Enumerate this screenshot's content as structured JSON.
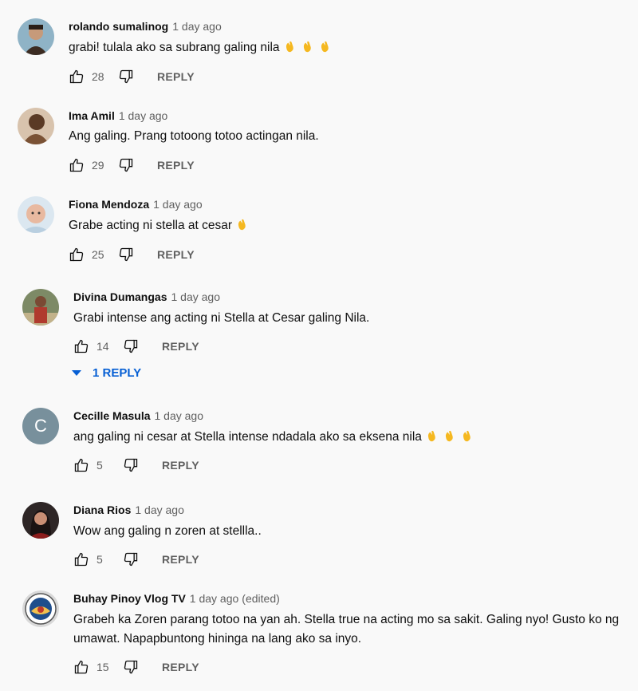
{
  "comments": [
    {
      "author": "rolando sumalinog",
      "time": "1 day ago",
      "text": "grabi! tulala ako sa subrang galing nila",
      "claps": 3,
      "likes": "28",
      "reply_label": "REPLY",
      "avatar_colors": [
        "#7fa3b8",
        "#3c2c22"
      ]
    },
    {
      "author": "Ima Amil",
      "time": "1 day ago",
      "text": "Ang galing. Prang totoong totoo actingan nila.",
      "claps": 0,
      "likes": "29",
      "reply_label": "REPLY",
      "avatar_colors": [
        "#c9ab8f",
        "#5a3a25"
      ]
    },
    {
      "author": "Fiona Mendoza",
      "time": "1 day ago",
      "text": "Grabe acting ni stella at cesar",
      "claps": 1,
      "likes": "25",
      "reply_label": "REPLY",
      "avatar_colors": [
        "#dbe7f0",
        "#e8b9a0"
      ]
    },
    {
      "author": "Divina Dumangas",
      "time": "1 day ago",
      "text": "Grabi intense ang acting ni Stella at Cesar galing Nila.",
      "claps": 0,
      "likes": "14",
      "reply_label": "REPLY",
      "avatar_colors": [
        "#6c7f54",
        "#b03a2e"
      ],
      "replies_toggle": "1 REPLY"
    },
    {
      "author": "Cecille Masula",
      "time": "1 day ago",
      "text": "ang galing ni cesar at Stella intense ndadala ako sa eksena nila",
      "claps": 3,
      "likes": "5",
      "reply_label": "REPLY",
      "avatar_letter": "C",
      "avatar_colors": [
        "#78909c",
        "#ffffff"
      ]
    },
    {
      "author": "Diana Rios",
      "time": "1 day ago",
      "text": "Wow ang galing n zoren at stellla..",
      "claps": 0,
      "likes": "5",
      "reply_label": "REPLY",
      "avatar_colors": [
        "#3a2a2a",
        "#8c1d1d"
      ]
    },
    {
      "author": "Buhay Pinoy Vlog TV",
      "time": "1 day ago",
      "edited": "(edited)",
      "text": "Grabeh ka Zoren parang totoo na yan ah.  Stella true na acting mo sa sakit. Galing nyo! Gusto ko ng umawat. Napapbuntong hininga na lang ako sa inyo.",
      "claps": 0,
      "likes": "15",
      "reply_label": "REPLY",
      "avatar_colors": [
        "#e0e0e0",
        "#1f4e8c"
      ]
    }
  ],
  "colors": {
    "background": "#f9f9f9",
    "author": "#0f0f0f",
    "secondary": "#606060",
    "link_blue": "#065fd4",
    "clap": "#f5b820"
  },
  "icons": [
    "thumb-up-icon",
    "thumb-down-icon",
    "clapping-hands-emoji",
    "caret-down-icon"
  ]
}
